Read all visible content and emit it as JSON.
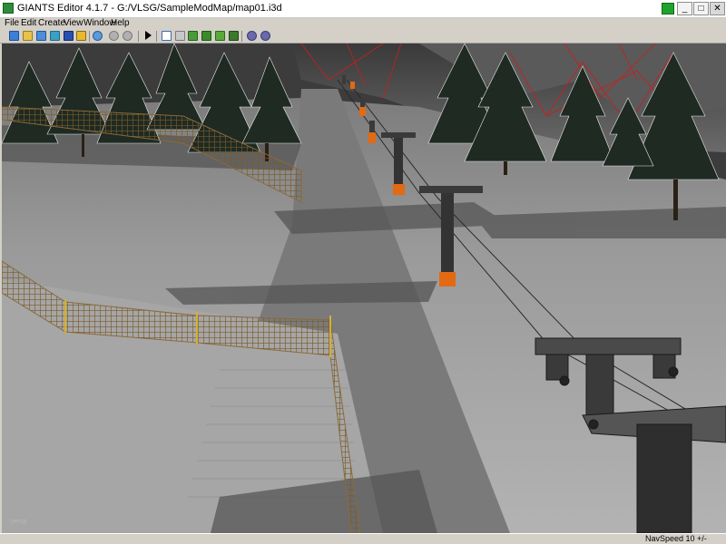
{
  "window": {
    "title": "GIANTS Editor 4.1.7 - G:/VLSG/SampleModMap/map01.i3d",
    "buttons": {
      "minimize": "_",
      "maximize": "□",
      "close": "✕"
    }
  },
  "menu": {
    "file": "File",
    "edit": "Edit",
    "create": "Create",
    "view": "View",
    "window": "Window",
    "help": "Help"
  },
  "toolbar": {
    "icons": [
      "new-icon",
      "open-icon",
      "import-icon",
      "export-icon",
      "save-icon",
      "save-all-icon",
      "undo-history-icon",
      "undo-icon",
      "redo-icon",
      "play-icon",
      "select-tool-icon",
      "move-tool-icon",
      "paint-terrain-icon",
      "paint-texture-icon",
      "paint-foliage-icon",
      "paint-decal-icon",
      "settings-icon",
      "properties-icon"
    ]
  },
  "viewport": {
    "watermark": "persp"
  },
  "statusbar": {
    "nav_speed": "NavSpeed 10 +/-"
  },
  "colors": {
    "chrome": "#d4d0c8",
    "tray_green": "#1fa32e",
    "lift_orange": "#e26a12",
    "fence_brown": "#8a6a3a"
  }
}
